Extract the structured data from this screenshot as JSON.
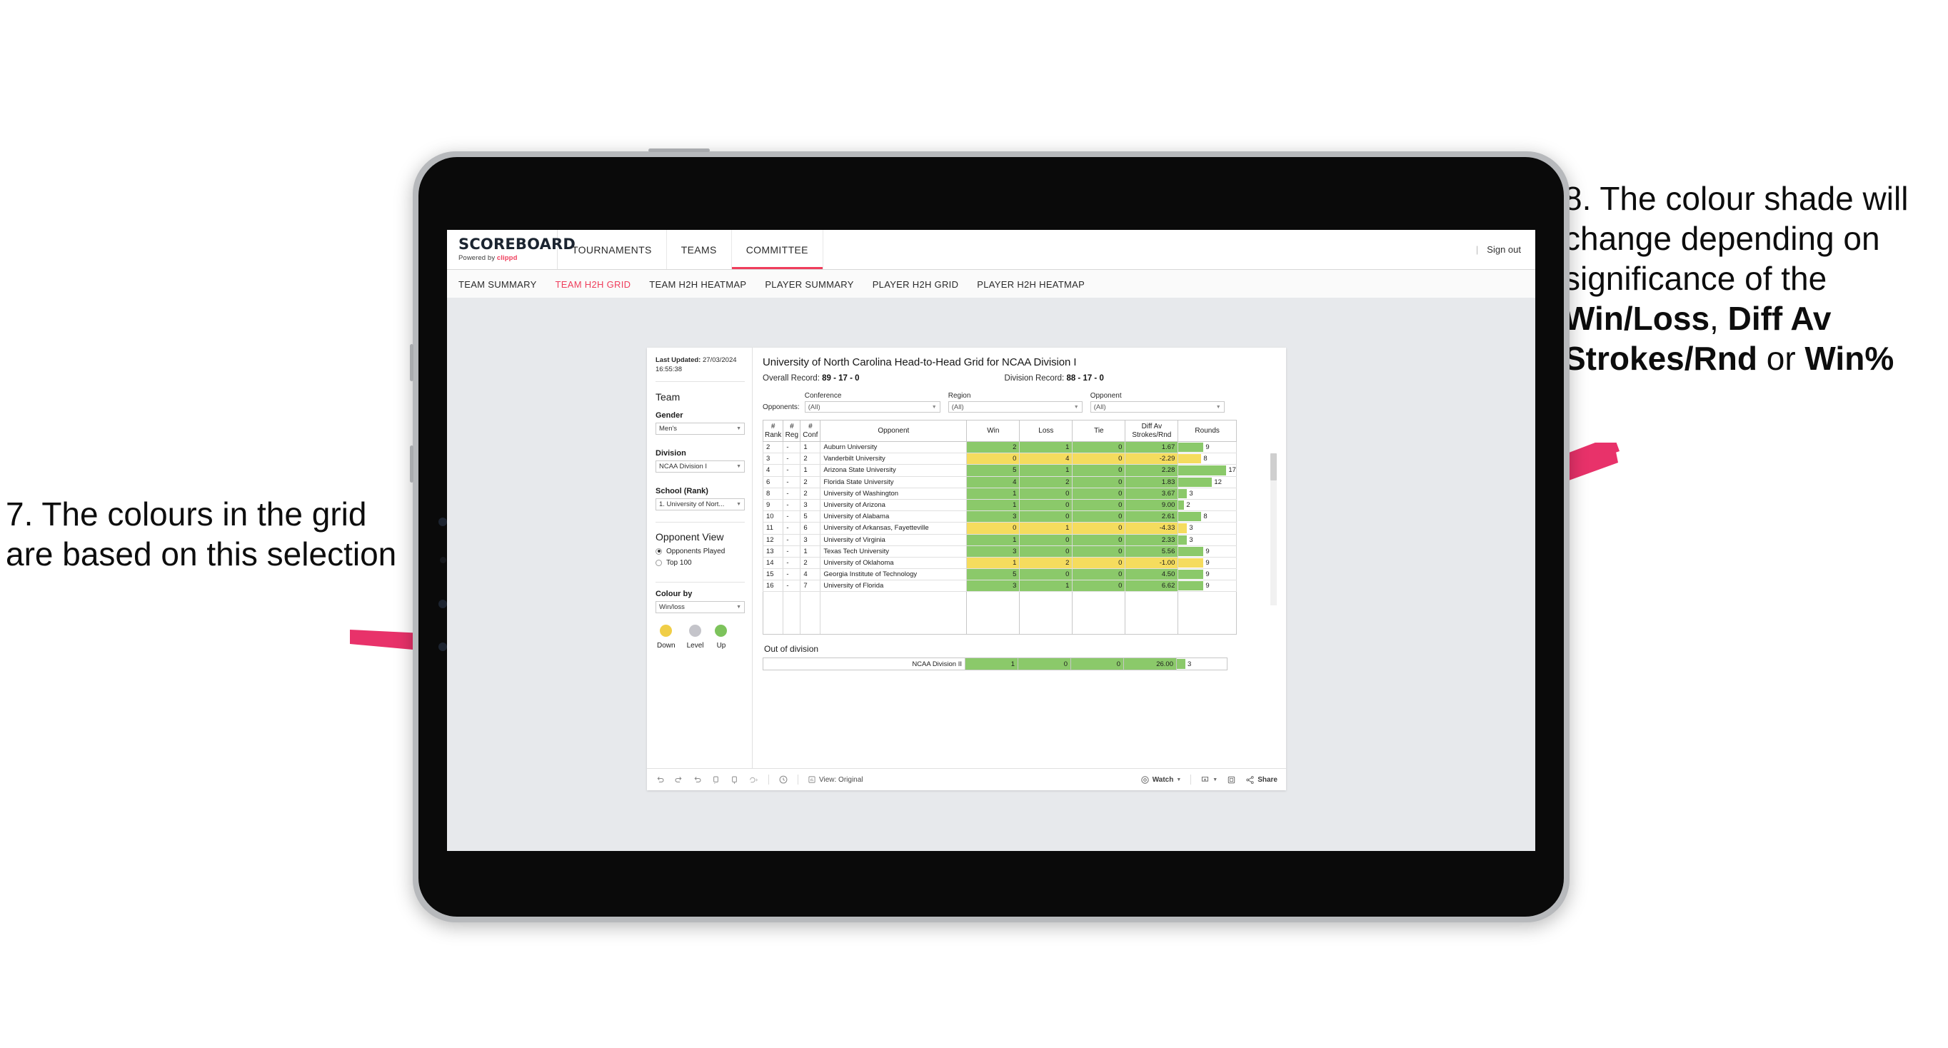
{
  "annotations": {
    "left": {
      "text": "7. The colours in the grid are based on this selection"
    },
    "right": {
      "pre": "8. The colour shade will change depending on significance of the ",
      "b1": "Win/Loss",
      "mid1": ", ",
      "b2": "Diff Av Strokes/Rnd",
      "mid2": " or ",
      "b3": "Win%"
    },
    "arrow_color": "#E8326A"
  },
  "app": {
    "brand": {
      "name": "SCOREBOARD",
      "powered_prefix": "Powered by ",
      "powered_brand": "clippd"
    },
    "nav": [
      {
        "label": "TOURNAMENTS",
        "active": false
      },
      {
        "label": "TEAMS",
        "active": false
      },
      {
        "label": "COMMITTEE",
        "active": true
      }
    ],
    "sign_out": "Sign out",
    "sign_out_divider": "|",
    "subnav": [
      {
        "label": "TEAM SUMMARY",
        "active": false
      },
      {
        "label": "TEAM H2H GRID",
        "active": true
      },
      {
        "label": "TEAM H2H HEATMAP",
        "active": false
      },
      {
        "label": "PLAYER SUMMARY",
        "active": false
      },
      {
        "label": "PLAYER H2H GRID",
        "active": false
      },
      {
        "label": "PLAYER H2H HEATMAP",
        "active": false
      }
    ],
    "accent": "#EF3E5C"
  },
  "filter_pane": {
    "last_updated_label": "Last Updated: ",
    "last_updated_value": "27/03/2024 16:55:38",
    "team_heading": "Team",
    "gender": {
      "label": "Gender",
      "value": "Men's"
    },
    "division": {
      "label": "Division",
      "value": "NCAA Division I"
    },
    "school": {
      "label": "School (Rank)",
      "value": "1. University of Nort..."
    },
    "opponent_view": {
      "heading": "Opponent View",
      "options": [
        {
          "label": "Opponents Played",
          "selected": true
        },
        {
          "label": "Top 100",
          "selected": false
        }
      ]
    },
    "colour_by": {
      "label": "Colour by",
      "value": "Win/loss"
    },
    "legend": [
      {
        "label": "Down",
        "color": "#F0CE47"
      },
      {
        "label": "Level",
        "color": "#C4C4CA"
      },
      {
        "label": "Up",
        "color": "#7DC35C"
      }
    ]
  },
  "viz": {
    "title": "University of North Carolina Head-to-Head Grid for NCAA Division I",
    "overall_label": "Overall Record: ",
    "overall_value": "89 - 17 - 0",
    "division_label": "Division Record: ",
    "division_value": "88 - 17 - 0",
    "opponents_label": "Opponents:",
    "filters": [
      {
        "label": "Conference",
        "value": "(All)"
      },
      {
        "label": "Region",
        "value": "(All)"
      },
      {
        "label": "Opponent",
        "value": "(All)"
      }
    ],
    "columns": [
      {
        "l1": "#",
        "l2": "Rank"
      },
      {
        "l1": "#",
        "l2": "Reg"
      },
      {
        "l1": "#",
        "l2": "Conf"
      },
      {
        "l1": "Opponent",
        "l2": ""
      },
      {
        "l1": "Win",
        "l2": ""
      },
      {
        "l1": "Loss",
        "l2": ""
      },
      {
        "l1": "Tie",
        "l2": ""
      },
      {
        "l1": "Diff Av",
        "l2": "Strokes/Rnd"
      },
      {
        "l1": "Rounds",
        "l2": ""
      }
    ],
    "rows": [
      {
        "rank": "2",
        "reg": "-",
        "conf": "1",
        "opponent": "Auburn University",
        "win": "2",
        "loss": "1",
        "tie": "0",
        "diff": "1.67",
        "rounds": "9",
        "rounds_n": 9,
        "color": "#8BC96A"
      },
      {
        "rank": "3",
        "reg": "-",
        "conf": "2",
        "opponent": "Vanderbilt University",
        "win": "0",
        "loss": "4",
        "tie": "0",
        "diff": "-2.29",
        "rounds": "8",
        "rounds_n": 8,
        "color": "#F5DC5E"
      },
      {
        "rank": "4",
        "reg": "-",
        "conf": "1",
        "opponent": "Arizona State University",
        "win": "5",
        "loss": "1",
        "tie": "0",
        "diff": "2.28",
        "rounds": "17",
        "rounds_n": 17,
        "color": "#8BC96A"
      },
      {
        "rank": "6",
        "reg": "-",
        "conf": "2",
        "opponent": "Florida State University",
        "win": "4",
        "loss": "2",
        "tie": "0",
        "diff": "1.83",
        "rounds": "12",
        "rounds_n": 12,
        "color": "#8BC96A"
      },
      {
        "rank": "8",
        "reg": "-",
        "conf": "2",
        "opponent": "University of Washington",
        "win": "1",
        "loss": "0",
        "tie": "0",
        "diff": "3.67",
        "rounds": "3",
        "rounds_n": 3,
        "color": "#8BC96A"
      },
      {
        "rank": "9",
        "reg": "-",
        "conf": "3",
        "opponent": "University of Arizona",
        "win": "1",
        "loss": "0",
        "tie": "0",
        "diff": "9.00",
        "rounds": "2",
        "rounds_n": 2,
        "color": "#8BC96A"
      },
      {
        "rank": "10",
        "reg": "-",
        "conf": "5",
        "opponent": "University of Alabama",
        "win": "3",
        "loss": "0",
        "tie": "0",
        "diff": "2.61",
        "rounds": "8",
        "rounds_n": 8,
        "color": "#8BC96A"
      },
      {
        "rank": "11",
        "reg": "-",
        "conf": "6",
        "opponent": "University of Arkansas, Fayetteville",
        "win": "0",
        "loss": "1",
        "tie": "0",
        "diff": "-4.33",
        "rounds": "3",
        "rounds_n": 3,
        "color": "#F5DC5E"
      },
      {
        "rank": "12",
        "reg": "-",
        "conf": "3",
        "opponent": "University of Virginia",
        "win": "1",
        "loss": "0",
        "tie": "0",
        "diff": "2.33",
        "rounds": "3",
        "rounds_n": 3,
        "color": "#8BC96A"
      },
      {
        "rank": "13",
        "reg": "-",
        "conf": "1",
        "opponent": "Texas Tech University",
        "win": "3",
        "loss": "0",
        "tie": "0",
        "diff": "5.56",
        "rounds": "9",
        "rounds_n": 9,
        "color": "#8BC96A"
      },
      {
        "rank": "14",
        "reg": "-",
        "conf": "2",
        "opponent": "University of Oklahoma",
        "win": "1",
        "loss": "2",
        "tie": "0",
        "diff": "-1.00",
        "rounds": "9",
        "rounds_n": 9,
        "color": "#F5DC5E"
      },
      {
        "rank": "15",
        "reg": "-",
        "conf": "4",
        "opponent": "Georgia Institute of Technology",
        "win": "5",
        "loss": "0",
        "tie": "0",
        "diff": "4.50",
        "rounds": "9",
        "rounds_n": 9,
        "color": "#8BC96A"
      },
      {
        "rank": "16",
        "reg": "-",
        "conf": "7",
        "opponent": "University of Florida",
        "win": "3",
        "loss": "1",
        "tie": "0",
        "diff": "6.62",
        "rounds": "9",
        "rounds_n": 9,
        "color": "#8BC96A"
      }
    ],
    "out_of_division": {
      "heading": "Out of division",
      "row": {
        "opponent": "NCAA Division II",
        "win": "1",
        "loss": "0",
        "tie": "0",
        "diff": "26.00",
        "rounds": "3",
        "rounds_n": 3,
        "color": "#8BC96A"
      }
    },
    "toolbar": {
      "view_label": "View: Original",
      "watch_label": "Watch",
      "share_label": "Share"
    }
  },
  "chart_data": {
    "type": "table",
    "title": "University of North Carolina Head-to-Head Grid for NCAA Division I",
    "columns": [
      "# Rank",
      "# Reg",
      "# Conf",
      "Opponent",
      "Win",
      "Loss",
      "Tie",
      "Diff Av Strokes/Rnd",
      "Rounds"
    ],
    "colour_by": "Win/loss",
    "colour_scale": {
      "Down": "#F0CE47",
      "Level": "#C4C4CA",
      "Up": "#7DC35C"
    },
    "rounds_max": 17,
    "rows": [
      [
        "2",
        "-",
        "1",
        "Auburn University",
        2,
        1,
        0,
        1.67,
        9
      ],
      [
        "3",
        "-",
        "2",
        "Vanderbilt University",
        0,
        4,
        0,
        -2.29,
        8
      ],
      [
        "4",
        "-",
        "1",
        "Arizona State University",
        5,
        1,
        0,
        2.28,
        17
      ],
      [
        "6",
        "-",
        "2",
        "Florida State University",
        4,
        2,
        0,
        1.83,
        12
      ],
      [
        "8",
        "-",
        "2",
        "University of Washington",
        1,
        0,
        0,
        3.67,
        3
      ],
      [
        "9",
        "-",
        "3",
        "University of Arizona",
        1,
        0,
        0,
        9.0,
        2
      ],
      [
        "10",
        "-",
        "5",
        "University of Alabama",
        3,
        0,
        0,
        2.61,
        8
      ],
      [
        "11",
        "-",
        "6",
        "University of Arkansas, Fayetteville",
        0,
        1,
        0,
        -4.33,
        3
      ],
      [
        "12",
        "-",
        "3",
        "University of Virginia",
        1,
        0,
        0,
        2.33,
        3
      ],
      [
        "13",
        "-",
        "1",
        "Texas Tech University",
        3,
        0,
        0,
        5.56,
        9
      ],
      [
        "14",
        "-",
        "2",
        "University of Oklahoma",
        1,
        2,
        0,
        -1.0,
        9
      ],
      [
        "15",
        "-",
        "4",
        "Georgia Institute of Technology",
        5,
        0,
        0,
        4.5,
        9
      ],
      [
        "16",
        "-",
        "7",
        "University of Florida",
        3,
        1,
        0,
        6.62,
        9
      ]
    ],
    "out_of_division": [
      [
        "NCAA Division II",
        1,
        0,
        0,
        26.0,
        3
      ]
    ],
    "records": {
      "overall": "89 - 17 - 0",
      "division": "88 - 17 - 0"
    }
  }
}
